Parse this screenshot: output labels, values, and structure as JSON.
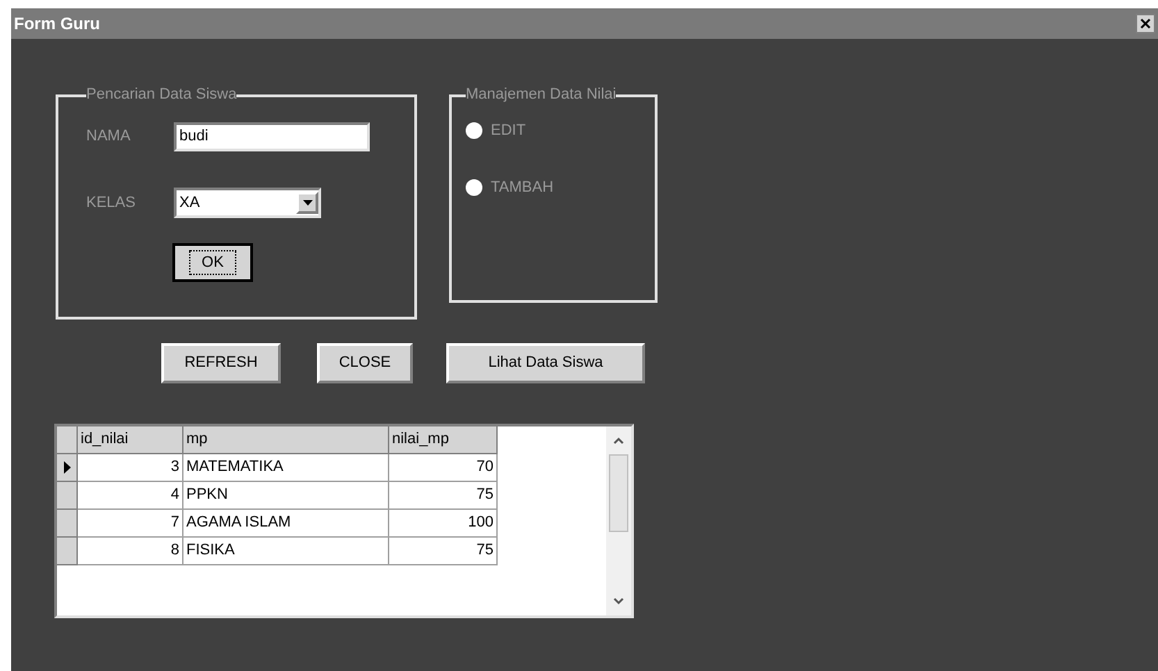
{
  "window": {
    "title": "Form Guru"
  },
  "search_group": {
    "title": "Pencarian Data Siswa",
    "name_label": "NAMA",
    "name_value": "budi",
    "class_label": "KELAS",
    "class_value": "XA",
    "ok_button": "OK"
  },
  "manage_group": {
    "title": "Manajemen Data Nilai",
    "options": [
      {
        "label": "EDIT",
        "selected": false
      },
      {
        "label": "TAMBAH",
        "selected": false
      }
    ]
  },
  "buttons": [
    "REFRESH",
    "CLOSE",
    "Lihat Data Siswa"
  ],
  "table": {
    "columns": [
      "id_nilai",
      "mp",
      "nilai_mp"
    ],
    "rows": [
      {
        "cells": [
          "3",
          "MATEMATIKA",
          "70"
        ],
        "selected": true
      },
      {
        "cells": [
          "4",
          "PPKN",
          "75"
        ],
        "selected": false
      },
      {
        "cells": [
          "7",
          "AGAMA ISLAM",
          "100"
        ],
        "selected": false
      },
      {
        "cells": [
          "8",
          "FISIKA",
          "75"
        ],
        "selected": false
      }
    ]
  }
}
